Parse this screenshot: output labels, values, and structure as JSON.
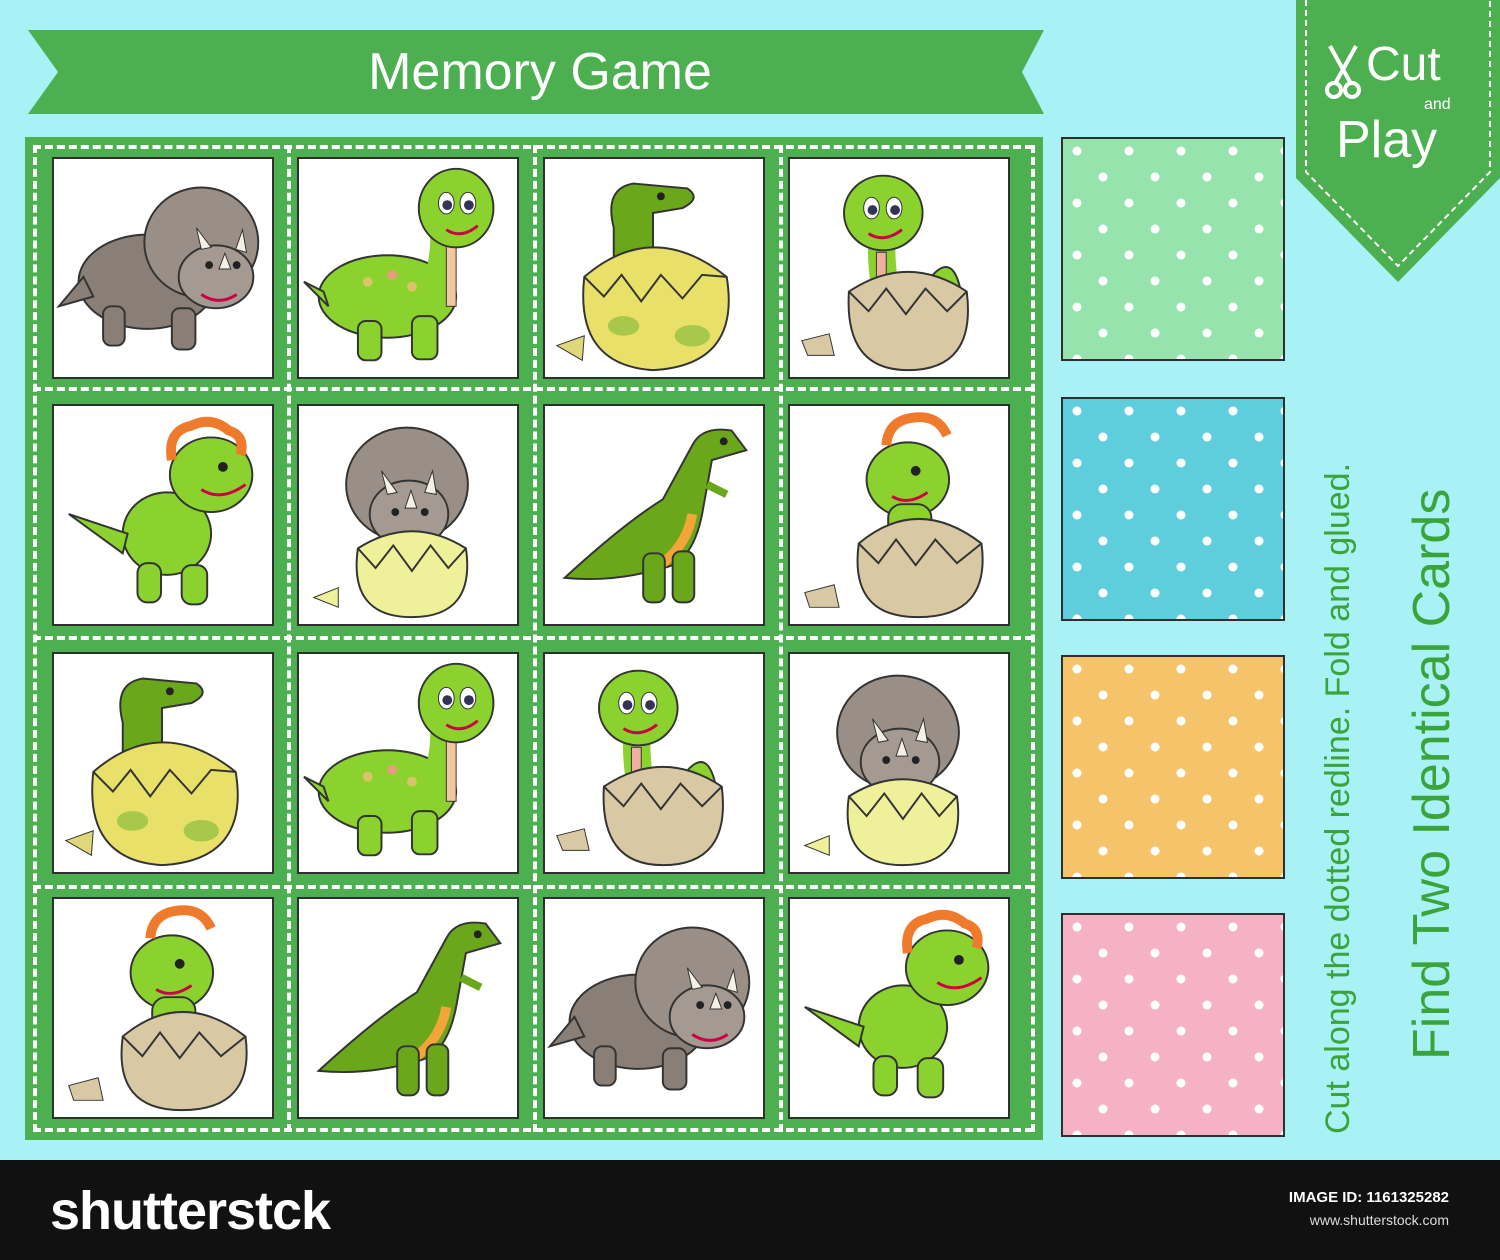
{
  "title": "Memory Game",
  "tag": {
    "cut": "Cut",
    "and": "and",
    "play": "Play"
  },
  "instructions": "Cut along the dotted redline. Fold and glued.",
  "headline": "Find Two Identical Cards",
  "cards": [
    {
      "icon": "triceratops-walking-icon"
    },
    {
      "icon": "brontosaurus-icon"
    },
    {
      "icon": "trex-in-yellow-egg-icon"
    },
    {
      "icon": "brontosaurus-in-egg-icon"
    },
    {
      "icon": "baby-dino-running-icon"
    },
    {
      "icon": "triceratops-in-egg-icon"
    },
    {
      "icon": "trex-standing-icon"
    },
    {
      "icon": "baby-dino-in-egg-icon"
    },
    {
      "icon": "trex-in-yellow-egg-icon"
    },
    {
      "icon": "brontosaurus-icon"
    },
    {
      "icon": "brontosaurus-in-egg-icon"
    },
    {
      "icon": "triceratops-in-egg-icon"
    },
    {
      "icon": "baby-dino-in-egg-icon"
    },
    {
      "icon": "trex-standing-icon"
    },
    {
      "icon": "triceratops-walking-icon"
    },
    {
      "icon": "baby-dino-running-icon"
    }
  ],
  "card_backs": [
    {
      "color": "#97e3ad"
    },
    {
      "color": "#5ecddc"
    },
    {
      "color": "#f5c46a"
    },
    {
      "color": "#f5b2c4"
    }
  ],
  "colors": {
    "green": "#4caf50",
    "sky": "#a8f1f5",
    "text_green": "#3aa43a"
  },
  "footer": {
    "logo": "shutterstck",
    "image_id": "IMAGE ID: 1161325282",
    "url": "www.shutterstock.com"
  }
}
